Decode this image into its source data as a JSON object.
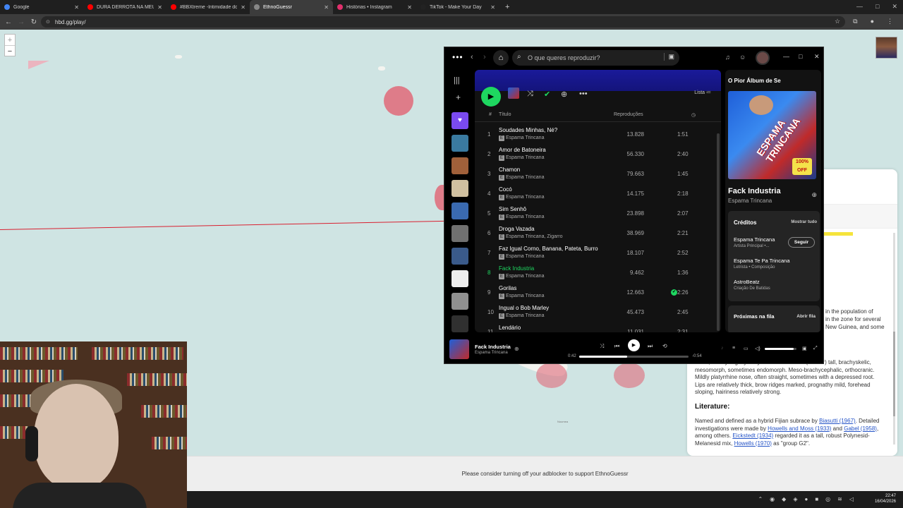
{
  "browser": {
    "tabs": [
      {
        "label": "Google",
        "color": "#4285f4",
        "active": false
      },
      {
        "label": "DURA DERROTA NA MEU SEGUI",
        "color": "#ff0000",
        "active": false
      },
      {
        "label": "#BBXtreme -Intimidade do ca",
        "color": "#ff0000",
        "active": false
      },
      {
        "label": "EthnoGuessr",
        "color": "#888888",
        "active": true
      },
      {
        "label": "Histórias • Instagram",
        "color": "#e1306c",
        "active": false
      },
      {
        "label": "TikTok - Make Your Day",
        "color": "#222222",
        "active": false
      }
    ],
    "url": "hbd.gg/play/"
  },
  "map": {
    "zoom_in": "+",
    "zoom_out": "−",
    "label_small": "Noumea"
  },
  "ethno_panel": {
    "fragment_1": "in the population of",
    "fragment_2": "in the zone for several",
    "fragment_3": "New Guinea, and some",
    "description": "Short, mostly slightly curly black-brown hair. (Rather) tall, brachyskelic, mesomorph, sometimes endomorph. Meso-brachycephalic, orthocranic. Mildly platyrrhine nose, often straight, sometimes with a depressed root. Lips are relatively thick, brow ridges marked, prognathy mild, forehead sloping, hairiness relatively strong.",
    "literature_heading": "Literature:",
    "lit_1": "Named and defined as a hybrid Fijian subrace by ",
    "lit_link_1": "Biasutti (1967)",
    "lit_2": ". Detailed investigations were made by ",
    "lit_link_2": "Howells and Moss (1933)",
    "lit_3": " and ",
    "lit_link_3": "Gabel (1958)",
    "lit_4": ", among others. ",
    "lit_link_4": "Eickstedt (1934)",
    "lit_5": " regarded it as a tall, robust Polynesid-Melanesid mix, ",
    "lit_link_5": "Howells (1970)",
    "lit_6": " as \"group G2\"."
  },
  "footer": {
    "adblock_message": "Please consider turning off your adblocker to support EthnoGuessr"
  },
  "taskbar": {
    "time": "22:47",
    "date": "16/04/2026"
  },
  "spotify": {
    "search_placeholder": "O que queres reproduzir?",
    "view_label": "Lista",
    "columns": {
      "number": "#",
      "title": "Título",
      "plays": "Reproduções"
    },
    "tracks": [
      {
        "n": "1",
        "title": "Soudades Minhas, Né?",
        "artist": "Espama Trincana",
        "plays": "13.828",
        "dur": "1:51"
      },
      {
        "n": "2",
        "title": "Amor de Batoneira",
        "artist": "Espama Trincana",
        "plays": "56.330",
        "dur": "2:40"
      },
      {
        "n": "3",
        "title": "Chamon",
        "artist": "Espama Trincana",
        "plays": "79.663",
        "dur": "1:45"
      },
      {
        "n": "4",
        "title": "Cocó",
        "artist": "Espama Trincana",
        "plays": "14.175",
        "dur": "2:18"
      },
      {
        "n": "5",
        "title": "Sim Senhô",
        "artist": "Espama Trincana",
        "plays": "23.898",
        "dur": "2:07"
      },
      {
        "n": "6",
        "title": "Droga Vazada",
        "artist": "Espama Trincana, Zigarro",
        "plays": "38.969",
        "dur": "2:21"
      },
      {
        "n": "7",
        "title": "Faz Igual Corno, Banana, Pateta, Burro",
        "artist": "Espama Trincana",
        "plays": "18.107",
        "dur": "2:52"
      },
      {
        "n": "8",
        "title": "Fack Industria",
        "artist": "Espama Trincana",
        "plays": "9.462",
        "dur": "1:36"
      },
      {
        "n": "9",
        "title": "Gorilas",
        "artist": "Espama Trincana",
        "plays": "12.663",
        "dur": "2:26"
      },
      {
        "n": "10",
        "title": "Ingual o Bob Marley",
        "artist": "Espama Trincana",
        "plays": "45.473",
        "dur": "2:45"
      },
      {
        "n": "11",
        "title": "Lendário",
        "artist": "",
        "plays": "11.031",
        "dur": "2:31"
      }
    ],
    "now_playing_panel": {
      "album_title": "O Pior Álbum de Se",
      "cover_text": "ESPAMA TRINCANA",
      "cover_stamp": "100% OFF",
      "song": "Fack Industria",
      "artist": "Espama Trincana",
      "credits_heading": "Créditos",
      "show_all": "Mostrar tudo",
      "credits": [
        {
          "name": "Espama Trincana",
          "role": "Artista Principal •..."
        },
        {
          "name": "Espama Te Pa Trincana",
          "role": "Letrista • Composição"
        },
        {
          "name": "AstroBeatz",
          "role": "Criação De Batidas"
        }
      ],
      "follow_label": "Seguir",
      "queue_heading": "Próximas na fila",
      "queue_open": "Abrir fila"
    },
    "player": {
      "title": "Fack Industria",
      "artist": "Espama Trincana",
      "elapsed": "0:42",
      "remaining": "-0:54",
      "progress": 0.44,
      "volume": 0.9
    }
  }
}
